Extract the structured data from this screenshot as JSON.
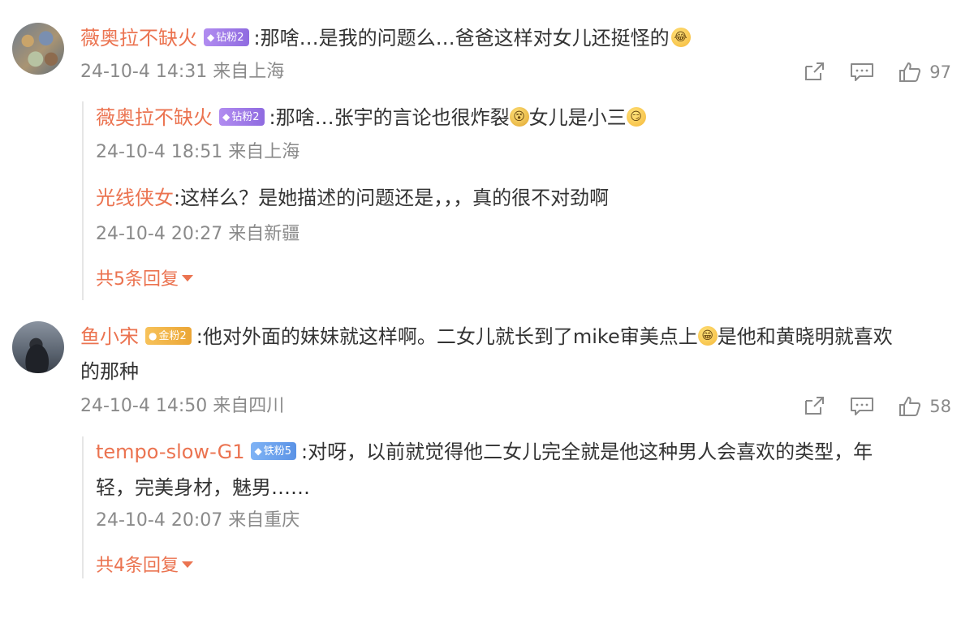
{
  "comments": [
    {
      "username": "薇奥拉不缺火",
      "badge": "钻粉2",
      "text": ":那啥…是我的问题么…爸爸这样对女儿还挺怪的",
      "meta": "24-10-4 14:31 来自上海",
      "likes": "97",
      "replies": [
        {
          "username": "薇奥拉不缺火",
          "badge": "钻粉2",
          "text_a": ":那啥…张宇的言论也很炸裂",
          "text_b": "女儿是小三",
          "meta": "24-10-4 18:51 来自上海"
        },
        {
          "username": "光线侠女",
          "text": ":这样么？是她描述的问题还是，，，真的很不对劲啊",
          "meta": "24-10-4 20:27 来自新疆"
        }
      ],
      "more_replies": "共5条回复"
    },
    {
      "username": "鱼小宋",
      "badge": "金粉2",
      "text_a": ":他对外面的妹妹就这样啊。二女儿就长到了mike审美点上",
      "text_b": "是他和黄晓明就喜欢",
      "text_line2": "的那种",
      "meta": "24-10-4 14:50 来自四川",
      "likes": "58",
      "replies": [
        {
          "username": "tempo-slow-G1",
          "badge": "铁粉5",
          "text": ":对呀，以前就觉得他二女儿完全就是他这种男人会喜欢的类型，年",
          "text_line2": "轻，完美身材，魅男……",
          "meta": "24-10-4 20:07 来自重庆"
        }
      ],
      "more_replies": "共4条回复"
    }
  ],
  "icons": {
    "share": "share-icon",
    "comment": "comment-icon",
    "like": "thumbs-up-icon",
    "emoji_cry": "crying-laugh-emoji",
    "emoji_shocked": "shocked-emoji",
    "emoji_smug": "smug-emoji",
    "emoji_grin": "grin-emoji"
  },
  "colors": {
    "username": "#eb7350",
    "text": "#333333",
    "meta": "#8a8a8a",
    "badge_diamond": "#9b76e8",
    "badge_gold": "#f0b040",
    "badge_iron": "#6aa2ee"
  }
}
